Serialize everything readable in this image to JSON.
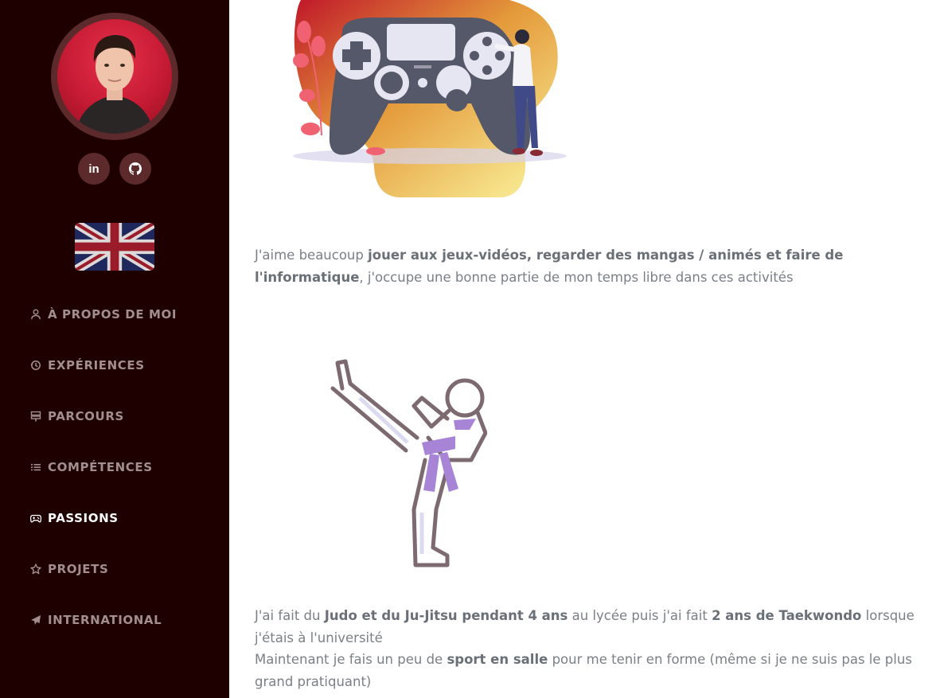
{
  "sidebar": {
    "social": [
      {
        "name": "linkedin-icon",
        "label": "in"
      },
      {
        "name": "github-icon",
        "label": ""
      }
    ],
    "language_flag": "uk-flag",
    "nav": [
      {
        "label": "À PROPOS DE MOI",
        "icon": "user-icon",
        "active": false
      },
      {
        "label": "EXPÉRIENCES",
        "icon": "history-icon",
        "active": false
      },
      {
        "label": "PARCOURS",
        "icon": "signpost-icon",
        "active": false
      },
      {
        "label": "COMPÉTENCES",
        "icon": "list-icon",
        "active": false
      },
      {
        "label": "PASSIONS",
        "icon": "gamepad-icon",
        "active": true
      },
      {
        "label": "PROJETS",
        "icon": "star-icon",
        "active": false
      },
      {
        "label": "INTERNATIONAL",
        "icon": "plane-icon",
        "active": false
      }
    ]
  },
  "main": {
    "p1": {
      "t1": "J'aime beaucoup ",
      "b1": "jouer aux jeux-vidéos, regarder des mangas / animés et faire de l'informatique",
      "t2": ", j'occupe une bonne partie de mon temps libre dans ces activités"
    },
    "p2": {
      "t1": "J'ai fait du ",
      "b1": "Judo et du Ju-Jitsu pendant 4 ans",
      "t2": " au lycée puis j'ai fait ",
      "b2": "2 ans de Taekwondo",
      "t3": " lorsque j'étais à l'université",
      "t4": "Maintenant je fais un peu de ",
      "b3": "sport en salle",
      "t5": " pour me tenir en forme (même si je ne suis pas le plus grand pratiquant)"
    }
  },
  "colors": {
    "sidebar_bg": "#1f0000",
    "nav_text": "#a28e8e",
    "nav_active": "#ffffff",
    "accent_circle": "#5c2a2a",
    "body_text": "#7a8088"
  }
}
